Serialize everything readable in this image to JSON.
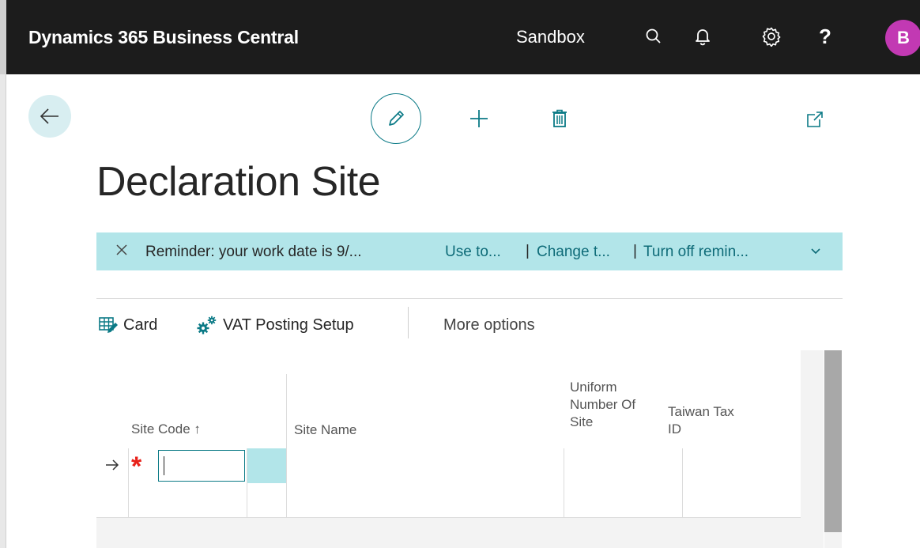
{
  "topbar": {
    "brand": "Dynamics 365 Business Central",
    "environment": "Sandbox",
    "help": "?",
    "avatar_initial": "B"
  },
  "page": {
    "title": "Declaration Site"
  },
  "reminder": {
    "message": "Reminder: your work date is 9/...",
    "action_use": "Use to...",
    "separator": "|",
    "action_change": "Change t...",
    "action_turn_off": "Turn off remin..."
  },
  "actions": {
    "card": "Card",
    "vat_posting_setup": "VAT Posting Setup",
    "more_options": "More options"
  },
  "grid": {
    "headers": {
      "site_code": "Site Code ↑",
      "site_name": "Site Name",
      "uniform_line1": "Uniform",
      "uniform_line2": "Number Of",
      "uniform_line3": "Site",
      "taiwan_line1": "Taiwan Tax",
      "taiwan_line2": "ID"
    },
    "required_marker": "*",
    "site_code_value": ""
  },
  "colors": {
    "topbar": "#1c1c1c",
    "accent": "#0b7a86",
    "reminder_bg": "#b2e5e9",
    "avatar": "#c239b3",
    "required": "#e8211a"
  }
}
